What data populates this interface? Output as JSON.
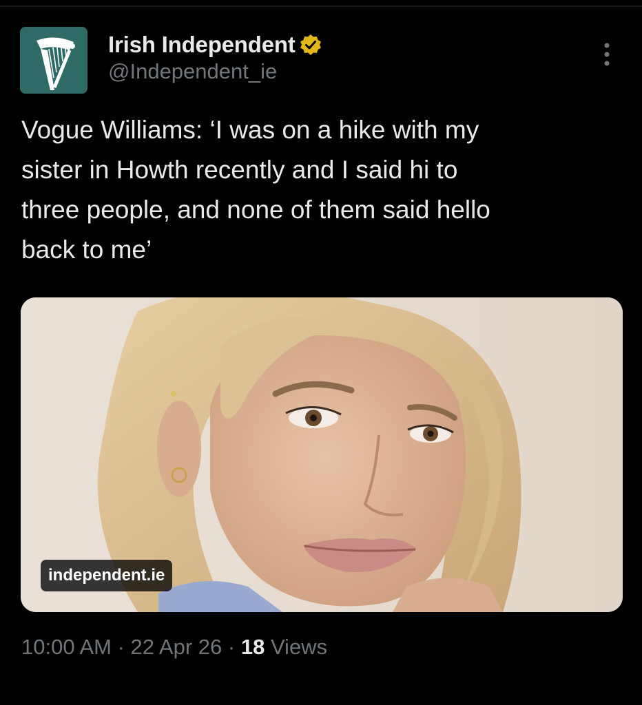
{
  "account": {
    "display_name": "Irish Independent",
    "handle": "@Independent_ie",
    "verified_icon": "verified-badge-icon",
    "avatar_icon": "harp-logo-icon",
    "avatar_color": "#2f6b66",
    "verified_color": "#e2b719"
  },
  "tweet": {
    "text": "Vogue Williams: ‘I was on a hike with my\nsister in Howth recently and I said hi to\nthree people, and none of them said hello\nback to me’"
  },
  "media": {
    "domain_label": "independent.ie"
  },
  "meta": {
    "time": "10:00 AM",
    "separator": " · ",
    "date": "22 Apr 26",
    "views_count": "18",
    "views_label": "Views"
  },
  "colors": {
    "background": "#000000",
    "primary_text": "#e7e9ea",
    "secondary_text": "#71767b"
  }
}
